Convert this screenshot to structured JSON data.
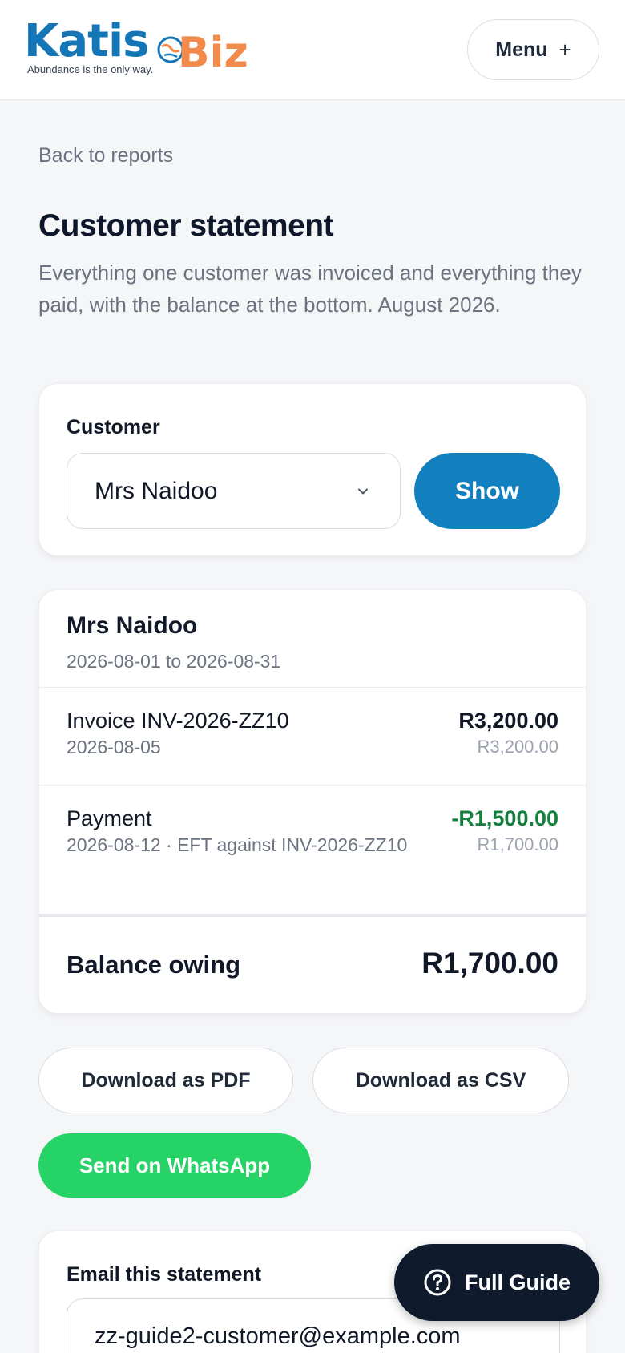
{
  "header": {
    "logo_katis": "Katis",
    "logo_biz": "Biz",
    "logo_tagline": "Abundance is the only way.",
    "menu_label": "Menu",
    "menu_icon": "+"
  },
  "page": {
    "back_link": "Back to reports",
    "title": "Customer statement",
    "description": "Everything one customer was invoiced and everything they paid, with the balance at the bottom. August 2026."
  },
  "customer_picker": {
    "label": "Customer",
    "selected": "Mrs Naidoo",
    "show_label": "Show"
  },
  "statement": {
    "customer_name": "Mrs Naidoo",
    "date_range": "2026-08-01 to 2026-08-31",
    "rows": [
      {
        "title": "Invoice INV-2026-ZZ10",
        "subtitle": "2026-08-05",
        "amount": "R3,200.00",
        "running_balance": "R3,200.00"
      },
      {
        "title": "Payment",
        "subtitle": "2026-08-12 · EFT against INV-2026-ZZ10",
        "amount": "-R1,500.00",
        "running_balance": "R1,700.00"
      }
    ],
    "balance_label": "Balance owing",
    "balance_value": "R1,700.00"
  },
  "actions": {
    "download_pdf": "Download as PDF",
    "download_csv": "Download as CSV",
    "send_whatsapp": "Send on WhatsApp"
  },
  "email": {
    "label": "Email this statement",
    "value": "zz-guide2-customer@example.com"
  },
  "guide": {
    "label": "Full Guide"
  },
  "colors": {
    "brand_blue": "#1476b7",
    "brand_orange": "#f28a4b",
    "show_button": "#127fbf",
    "whatsapp_green": "#25d366",
    "negative_amount": "#15803d",
    "guide_button": "#0f1b2d"
  }
}
